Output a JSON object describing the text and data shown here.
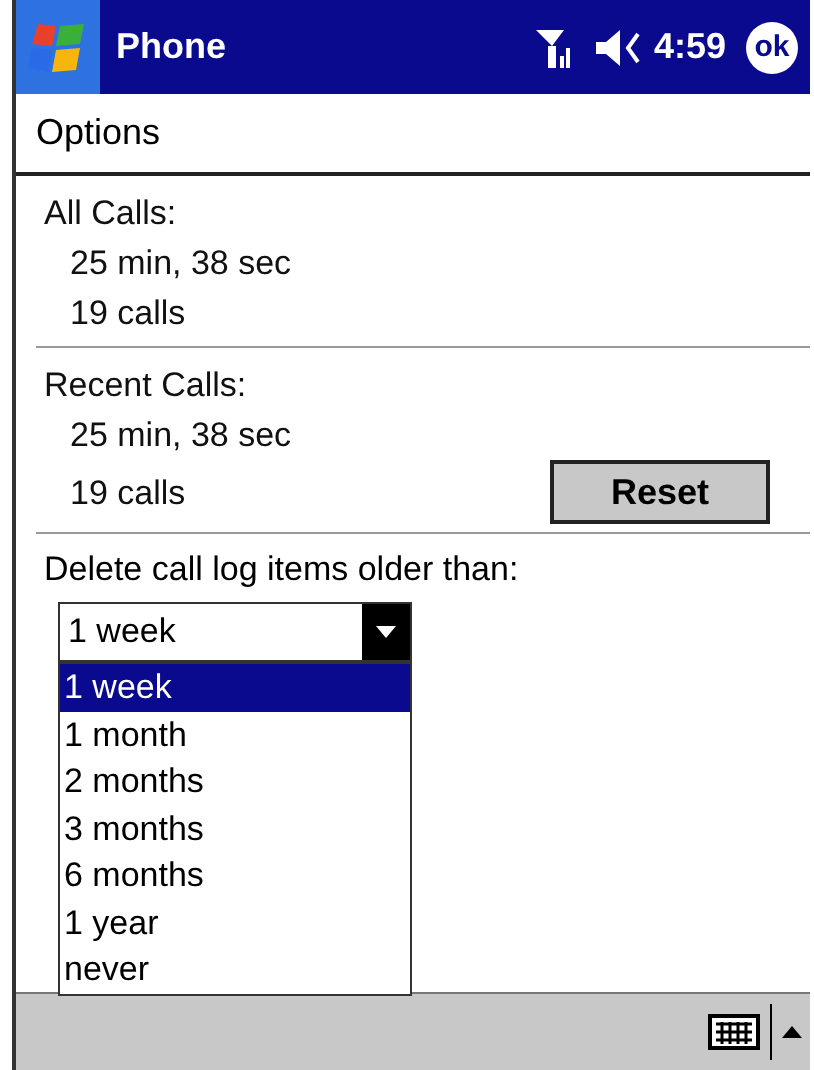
{
  "window": {
    "title": "Phone",
    "time": "4:59",
    "ok_button": "ok"
  },
  "header": "Options",
  "sections": [
    {
      "label": "All Calls:",
      "lines": [
        "25 min, 38 sec",
        "19 calls"
      ]
    },
    {
      "label": "Recent Calls:",
      "lines": [
        "25 min, 38 sec",
        "19 calls"
      ],
      "button": "Reset"
    }
  ],
  "delete_label": "Delete call log items older than:",
  "dropdown": {
    "value": "1 week",
    "expanded": true,
    "options": [
      {
        "label": "1 week",
        "selected": true
      },
      {
        "label": "1 month",
        "selected": false
      },
      {
        "label": "2 months",
        "selected": false
      },
      {
        "label": "3 months",
        "selected": false
      },
      {
        "label": "6 months",
        "selected": false
      },
      {
        "label": "1 year",
        "selected": false
      },
      {
        "label": "never",
        "selected": false
      }
    ]
  }
}
